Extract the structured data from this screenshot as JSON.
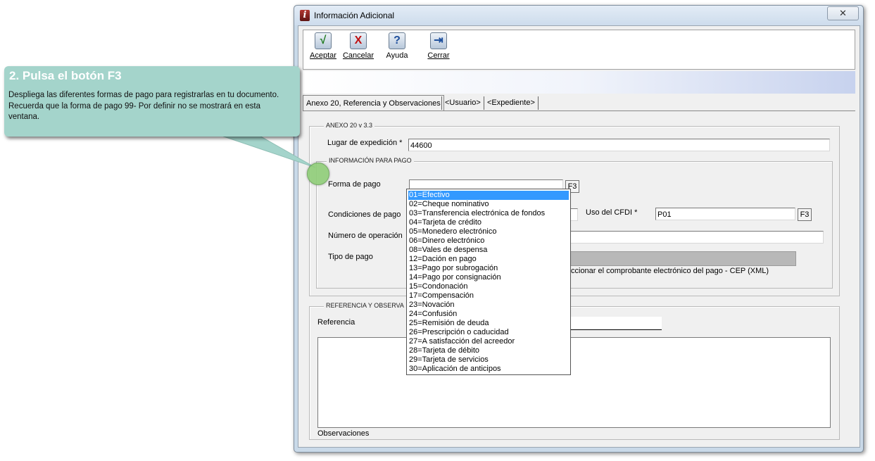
{
  "window": {
    "title": "Información Adicional",
    "close_label": "✕"
  },
  "toolbar": {
    "aceptar": "Aceptar",
    "cancelar": "Cancelar",
    "ayuda": "Ayuda",
    "cerrar": "Cerrar"
  },
  "tabs": {
    "anexo": "Anexo 20, Referencia y Observaciones",
    "usuario": "<Usuario>",
    "expediente": "<Expediente>"
  },
  "anexo": {
    "group_title": "ANEXO 20 v 3.3",
    "lugar_label": "Lugar de expedición *",
    "lugar_value": "44600"
  },
  "pago": {
    "group_title": "INFORMACIÓN PARA PAGO",
    "forma_label": "Forma de pago",
    "forma_value": "",
    "f3": "F3",
    "condiciones_label": "Condiciones de pago",
    "uso_label": "Uso del CFDI *",
    "uso_value": "P01",
    "numero_label": "Número de operación",
    "tipo_label": "Tipo de pago",
    "cep_text": "ccionar el comprobante electrónico del pago - CEP (XML)"
  },
  "referencia": {
    "group_title": "REFERENCIA Y OBSERVA",
    "referencia_label": "Referencia",
    "observaciones_label": "Observaciones"
  },
  "dropdown_items": [
    "01=Efectivo",
    "02=Cheque nominativo",
    "03=Transferencia electrónica de fondos",
    "04=Tarjeta de crédito",
    "05=Monedero electrónico",
    "06=Dinero electrónico",
    "08=Vales de despensa",
    "12=Dación en pago",
    "13=Pago por subrogación",
    "14=Pago por consignación",
    "15=Condonación",
    "17=Compensación",
    "23=Novación",
    "24=Confusión",
    "25=Remisión de deuda",
    "26=Prescripción o caducidad",
    "27=A satisfacción del acreedor",
    "28=Tarjeta de débito",
    "29=Tarjeta de servicios",
    "30=Aplicación de anticipos"
  ],
  "callout": {
    "title": "2. Pulsa el botón F3",
    "body": "Despliega las diferentes formas de pago para registrarlas en tu documento. Recuerda que la forma de pago 99- Por definir no se mostrará en esta ventana."
  },
  "colors": {
    "selection": "#3399ff",
    "callout_bg": "#a4d4cb",
    "marker": "#8fcd78"
  },
  "icons": {
    "aceptar": "checkmark-icon",
    "cancelar": "x-mark-icon",
    "ayuda": "question-icon",
    "cerrar": "exit-door-icon"
  }
}
